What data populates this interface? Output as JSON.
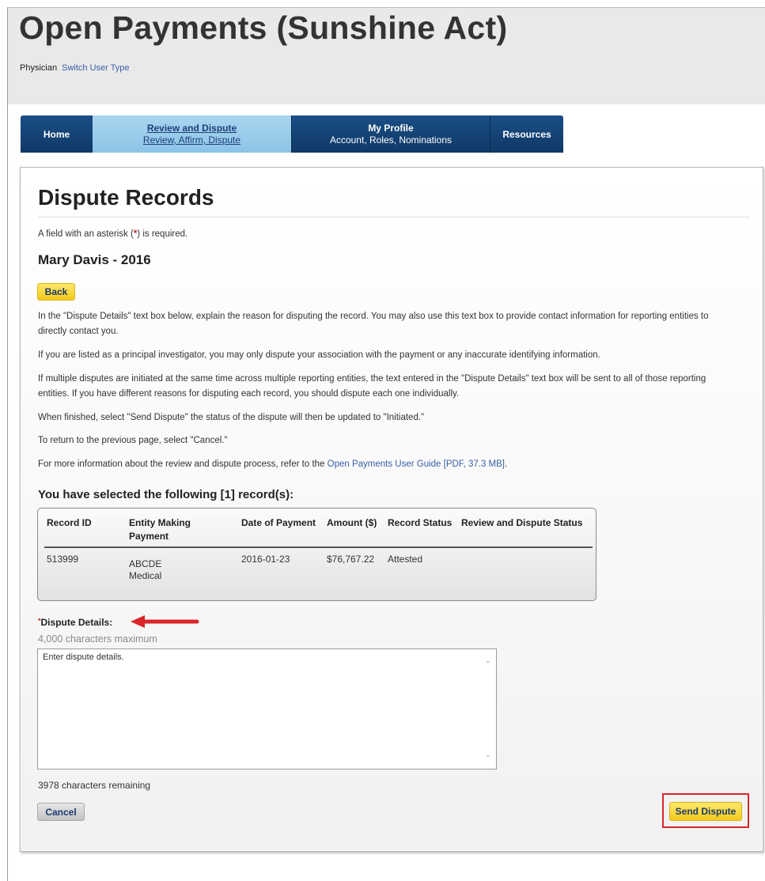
{
  "site": {
    "title": "Open Payments (Sunshine Act)",
    "user_type": "Physician",
    "switch_link": "Switch User Type"
  },
  "nav": {
    "home": "Home",
    "review_main": "Review and Dispute",
    "review_sub": "Review, Affirm, Dispute",
    "profile_main": "My Profile",
    "profile_sub": "Account, Roles, Nominations",
    "resources": "Resources"
  },
  "page": {
    "title": "Dispute Records",
    "required_note_pre": "A field with an asterisk (",
    "required_note_ast": "*",
    "required_note_post": ") is required.",
    "person": "Mary Davis - 2016",
    "back_label": "Back",
    "para1": "In the \"Dispute Details\" text box below, explain the reason for disputing the record. You may also use this text box to provide contact information for reporting entities to directly contact you.",
    "para2": "If you are listed as a principal investigator, you may only dispute your association with the payment or any inaccurate identifying information.",
    "para3": "If multiple disputes are initiated at the same time across multiple reporting entities, the text entered in the \"Dispute Details\" text box will be sent to all of those reporting entities. If you have different reasons for disputing each record, you should dispute each one individually.",
    "para4": "When finished, select \"Send Dispute\" the status of the dispute will then be updated to \"Initiated.\"",
    "para5": "To return to the previous page, select \"Cancel.\"",
    "para6_pre": "For more information about the review and dispute process, refer to the ",
    "para6_link": "Open Payments User Guide [PDF, 37.3 MB]",
    "para6_post": ".",
    "selected_heading": "You have selected the following [1] record(s):"
  },
  "records": {
    "headers": {
      "record_id": "Record ID",
      "entity_line1": "Entity Making",
      "entity_line2": "Payment",
      "date": "Date of Payment",
      "amount": "Amount ($)",
      "status": "Record Status",
      "review_status": "Review and Dispute Status"
    },
    "rows": [
      {
        "record_id": "513999",
        "entity_line1": "ABCDE",
        "entity_line2": "Medical",
        "date": "2016-01-23",
        "amount": "$76,767.22",
        "status": "Attested",
        "review_status": ""
      }
    ]
  },
  "dispute": {
    "label_ast": "*",
    "label": "Dispute Details:",
    "max_note": "4,000 characters maximum",
    "placeholder": "Enter dispute details.",
    "remaining": "3978 characters remaining",
    "cancel_label": "Cancel",
    "send_label": "Send Dispute"
  },
  "colors": {
    "nav_dark": "#1b4f86",
    "nav_active": "#a9d5ef",
    "button_yellow": "#f4c91c",
    "highlight_red": "#d9262a",
    "link": "#3a5fa8"
  }
}
